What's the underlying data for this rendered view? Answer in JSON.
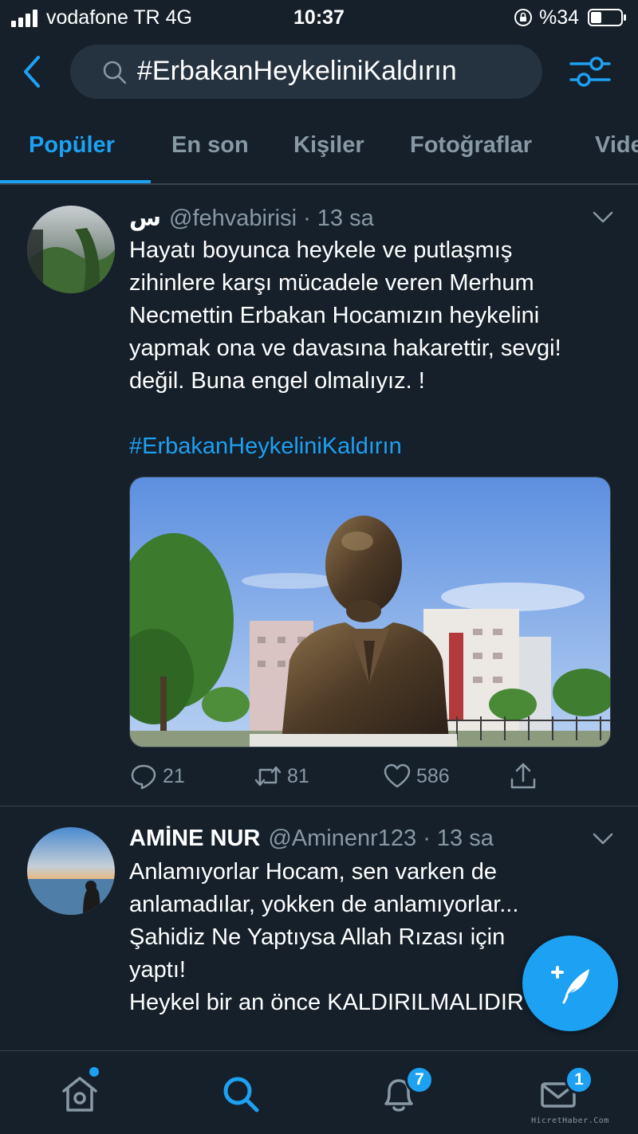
{
  "status_bar": {
    "carrier": "vodafone TR  4G",
    "time": "10:37",
    "battery": "%34"
  },
  "search": {
    "query": "#ErbakanHeykeliniKaldırın"
  },
  "tabs": [
    {
      "label": "Popüler",
      "active": true
    },
    {
      "label": "En son",
      "active": false
    },
    {
      "label": "Kişiler",
      "active": false
    },
    {
      "label": "Fotoğraflar",
      "active": false
    },
    {
      "label": "Vide",
      "active": false
    }
  ],
  "tweets": [
    {
      "name": "س",
      "handle": "@fehvabirisi",
      "time": " · 13 sa",
      "lines": [
        "Hayatı boyunca heykele ve putlaşmış",
        "zihinlere karşı mücadele veren Merhum",
        "Necmettin Erbakan Hocamızın heykelini",
        "yapmak ona ve davasına hakarettir, sevgi!",
        "değil. Buna engel olmalıyız. !"
      ],
      "hashtag": "#ErbakanHeykeliniKaldırın",
      "replies": "21",
      "retweets": "81",
      "likes": "586"
    },
    {
      "name": "AMİNE NUR",
      "handle": "@Aminenr123",
      "time": " · 13 sa",
      "lines": [
        "Anlamıyorlar Hocam, sen varken de",
        "anlamadılar, yokken de anlamıyorlar...",
        "Şahidiz Ne Yaptıysa Allah Rızası için",
        "yaptı!",
        "Heykel bir an önce KALDIRILMALIDIR"
      ]
    }
  ],
  "bottom_nav": {
    "notifications_badge": "7",
    "messages_badge": "1"
  },
  "watermark": "HicretHaber.Com",
  "colors": {
    "background": "#15202b",
    "accent": "#1da1f2",
    "muted": "#8899a6",
    "divider": "#38444d"
  }
}
